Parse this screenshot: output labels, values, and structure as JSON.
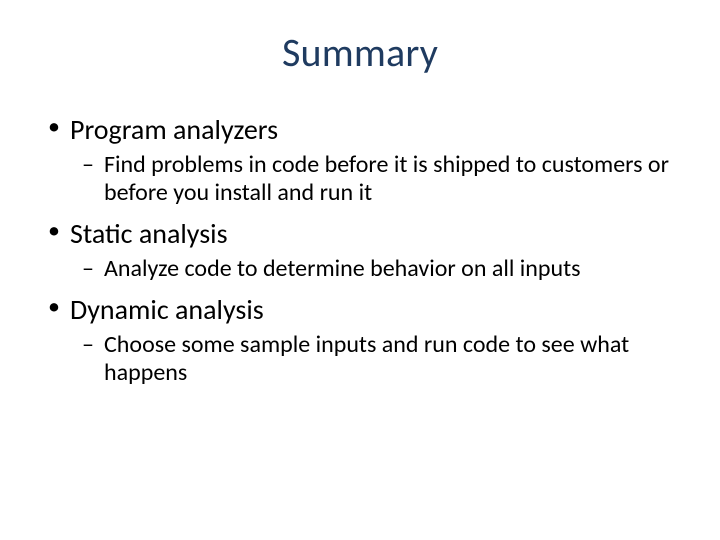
{
  "title": "Summary",
  "items": [
    {
      "l1": "Program analyzers",
      "l2": "Find problems in code before it is shipped to customers or before you install and run it"
    },
    {
      "l1": "Static analysis",
      "l2": "Analyze code to determine behavior on all inputs"
    },
    {
      "l1": "Dynamic analysis",
      "l2": "Choose some sample inputs and run code to see what happens"
    }
  ]
}
